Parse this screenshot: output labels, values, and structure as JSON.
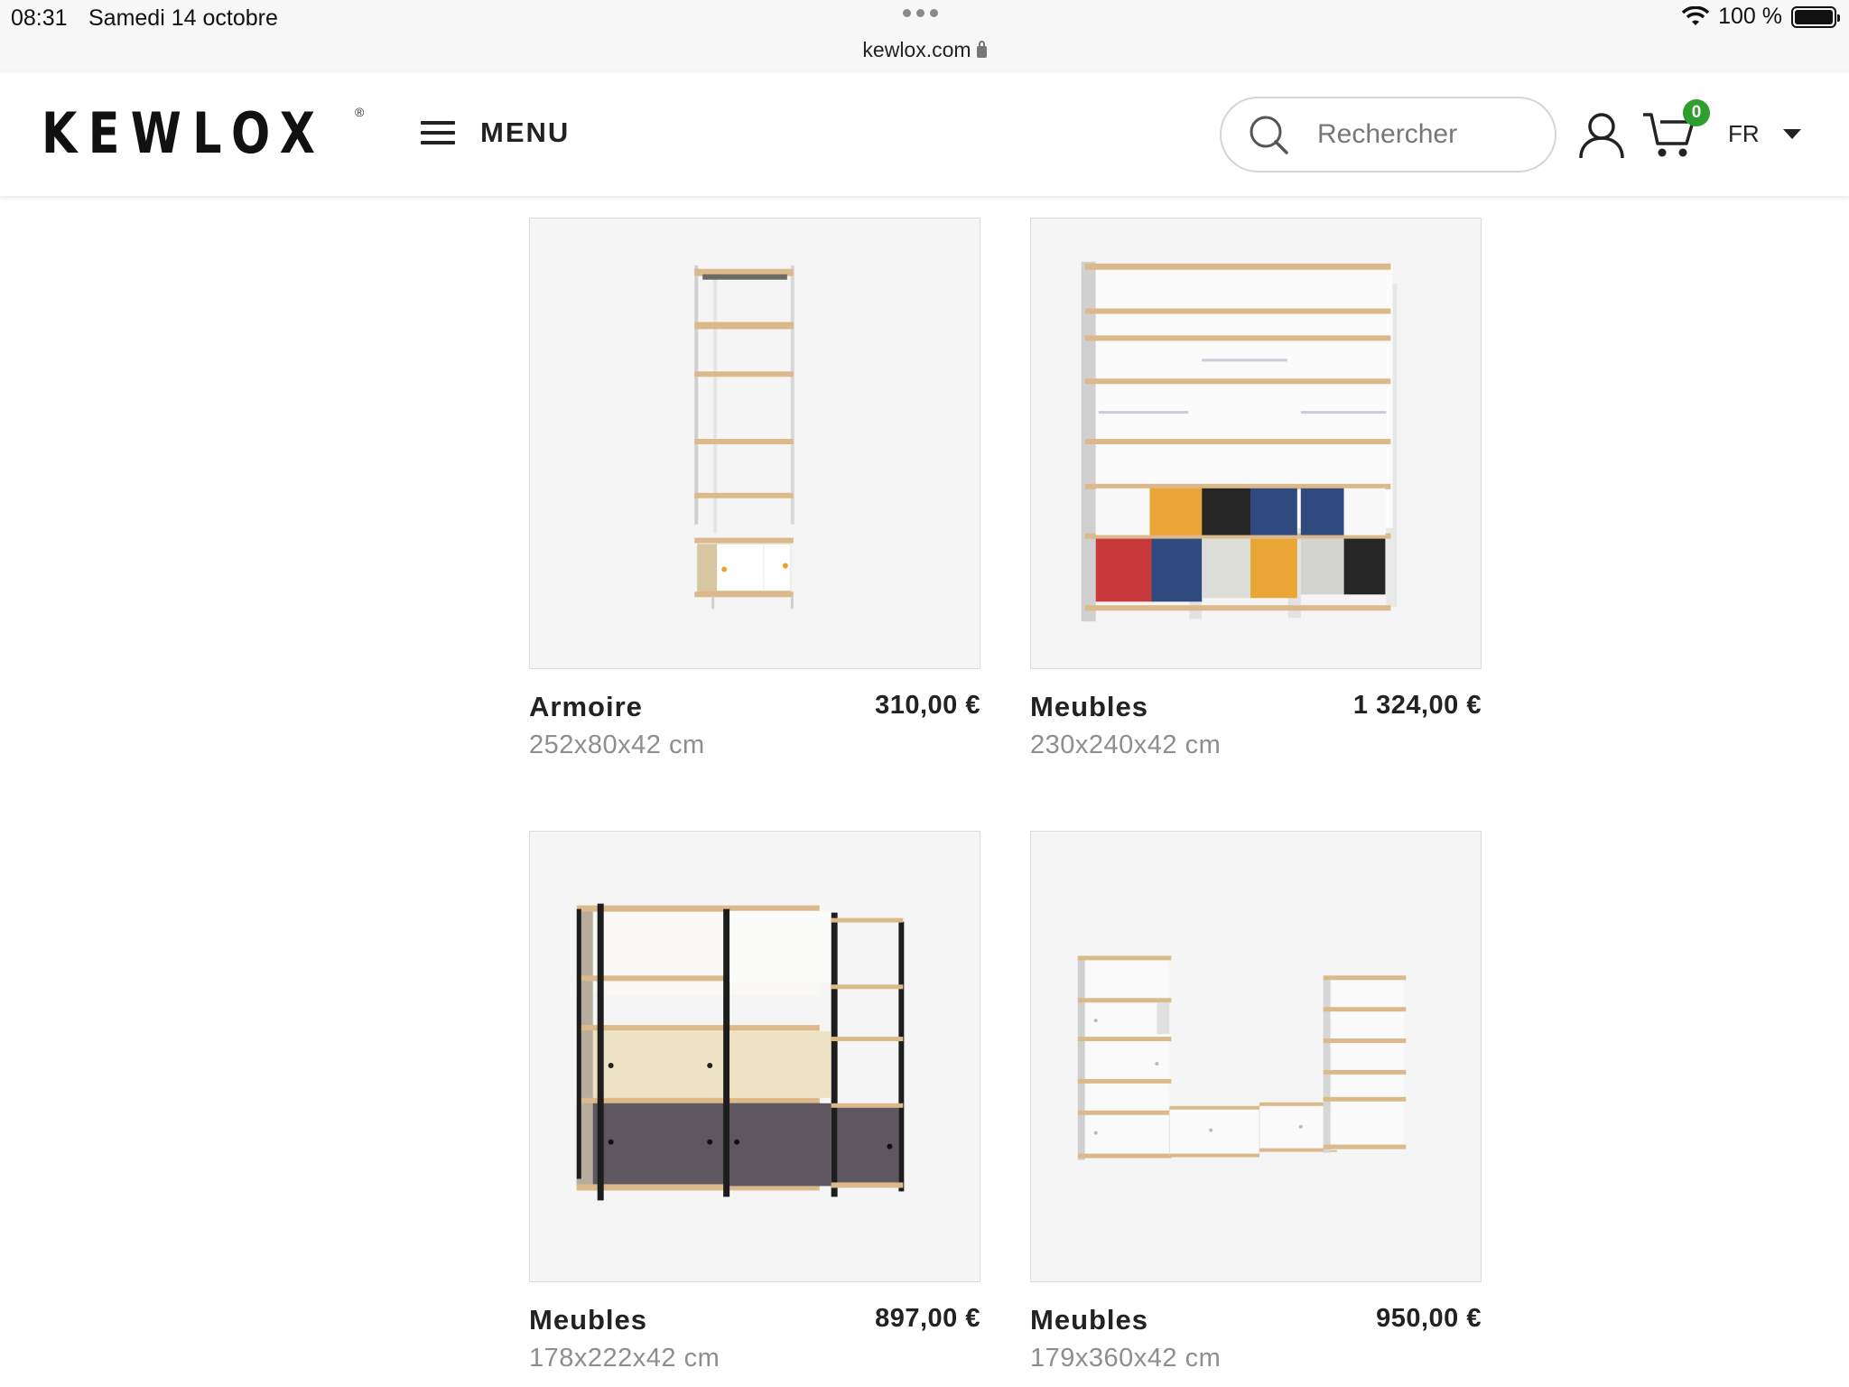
{
  "status_bar": {
    "time": "08:31",
    "date": "Samedi 14 octobre",
    "battery": "100 %",
    "battery_level": 1.0
  },
  "browser": {
    "url": "kewlox.com"
  },
  "header": {
    "logo": "KEWLOX",
    "logo_mark": "®",
    "menu_label": "MENU",
    "search_placeholder": "Rechercher",
    "cart_count": "0",
    "language": "FR",
    "colors": {
      "badge": "#2e9e2e"
    }
  },
  "products": [
    {
      "name": "Armoire",
      "price": "310,00 €",
      "dimensions": "252x80x42 cm",
      "image_icon": "wardrobe-image"
    },
    {
      "name": "Meubles",
      "price": "1 324,00 €",
      "dimensions": "230x240x42 cm",
      "image_icon": "furniture-image"
    },
    {
      "name": "Meubles",
      "price": "897,00 €",
      "dimensions": "178x222x42 cm",
      "image_icon": "furniture-image"
    },
    {
      "name": "Meubles",
      "price": "950,00 €",
      "dimensions": "179x360x42 cm",
      "image_icon": "furniture-image"
    }
  ]
}
